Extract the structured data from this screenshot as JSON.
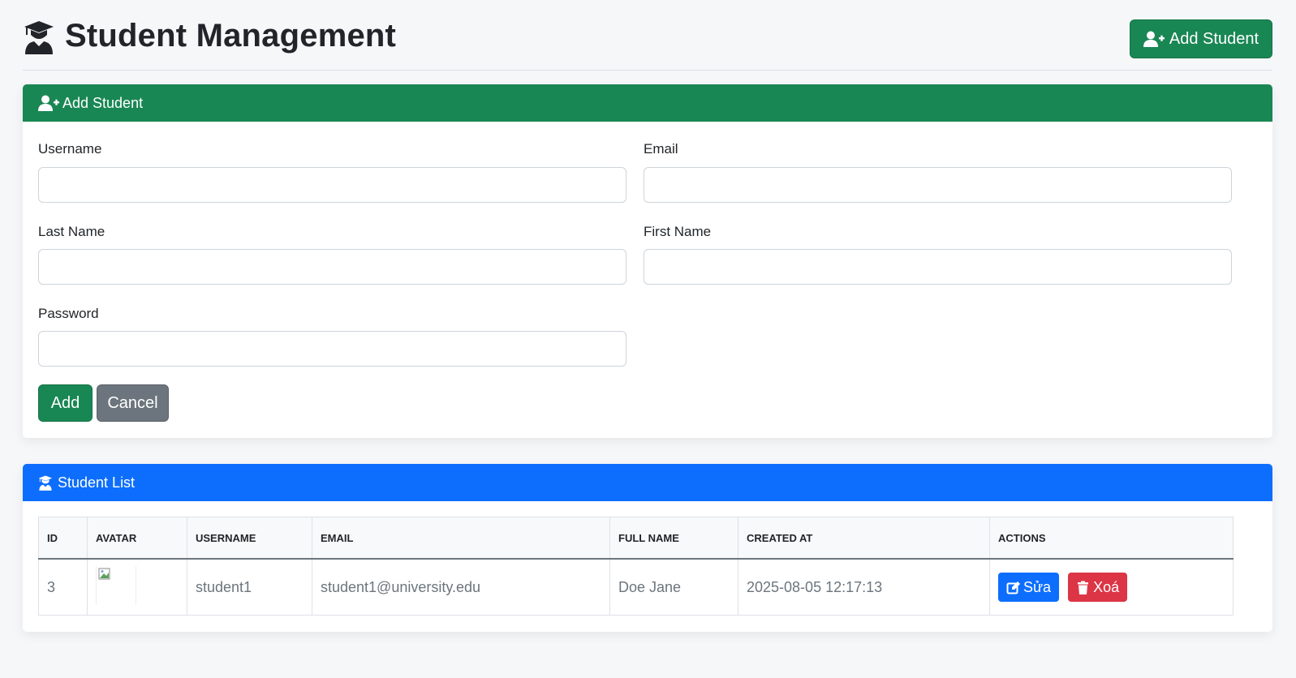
{
  "header": {
    "title": "Student Management",
    "add_button_label": "Add Student",
    "title_icon": "user-graduate-icon"
  },
  "form": {
    "heading": "Add Student",
    "fields": {
      "username": {
        "label": "Username",
        "value": "",
        "placeholder": ""
      },
      "email": {
        "label": "Email",
        "value": "",
        "placeholder": ""
      },
      "last_name": {
        "label": "Last Name",
        "value": "",
        "placeholder": ""
      },
      "first_name": {
        "label": "First Name",
        "value": "",
        "placeholder": ""
      },
      "password": {
        "label": "Password",
        "value": "",
        "placeholder": ""
      }
    },
    "add_label": "Add",
    "cancel_label": "Cancel"
  },
  "list": {
    "heading": "Student List",
    "columns": [
      "ID",
      "AVATAR",
      "USERNAME",
      "EMAIL",
      "FULL NAME",
      "CREATED AT",
      "ACTIONS"
    ],
    "rows": [
      {
        "id": "3",
        "avatar_alt": "",
        "username": "student1",
        "email": "student1@university.edu",
        "full_name": "Doe Jane",
        "created_at": "2025-08-05 12:17:13",
        "edit_label": "Sửa",
        "delete_label": "Xoá"
      }
    ]
  },
  "colors": {
    "success": "#198754",
    "primary": "#0d6efd",
    "secondary": "#6c757d",
    "danger": "#dc3545"
  }
}
